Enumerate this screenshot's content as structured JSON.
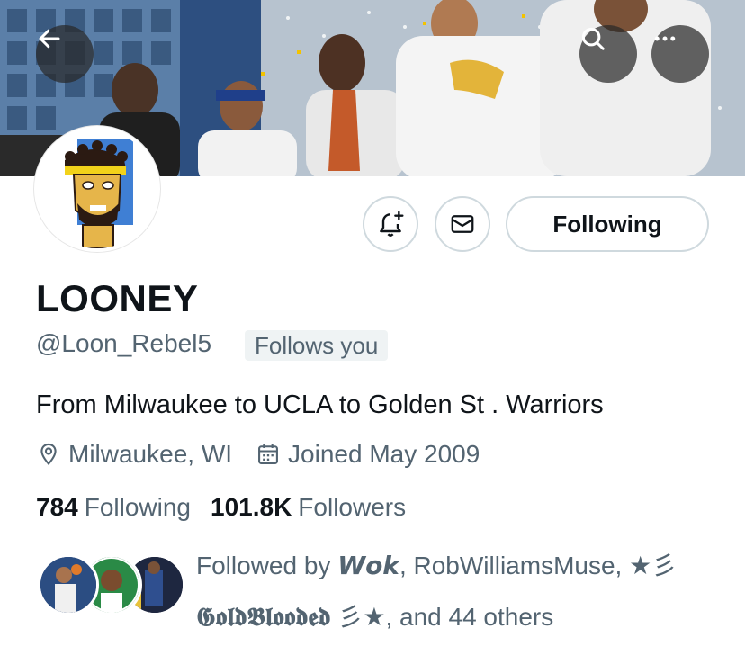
{
  "header": {
    "back_icon": "arrow-left-icon",
    "search_icon": "search-icon",
    "more_icon": "more-horizontal-icon"
  },
  "profile": {
    "name": "LOONEY",
    "handle": "@Loon_Rebel5",
    "follows_you": "Follows you",
    "bio": "From Milwaukee to UCLA to Golden St . Warriors",
    "location": "Milwaukee, WI",
    "joined": "Joined May 2009",
    "following_count": "784",
    "following_label": "Following",
    "followers_count": "101.8K",
    "followers_label": "Followers"
  },
  "actions": {
    "notify_icon": "bell-plus-icon",
    "mail_icon": "envelope-icon",
    "following_button": "Following"
  },
  "followed_by": {
    "prefix": "Followed by ",
    "user1": "𝙒𝙤𝙠",
    "sep1": ", ",
    "user2": "RobWilliamsMuse, ★彡",
    "user3": "𝕲𝖔𝖑𝖉𝕭𝖑𝖔𝖔𝖉𝖊𝖉",
    "suffix": " 彡★, and 44 others"
  },
  "colors": {
    "text_primary": "#0f1419",
    "text_secondary": "#536471",
    "border": "#cfd9de",
    "chip_bg": "#eff3f4"
  }
}
